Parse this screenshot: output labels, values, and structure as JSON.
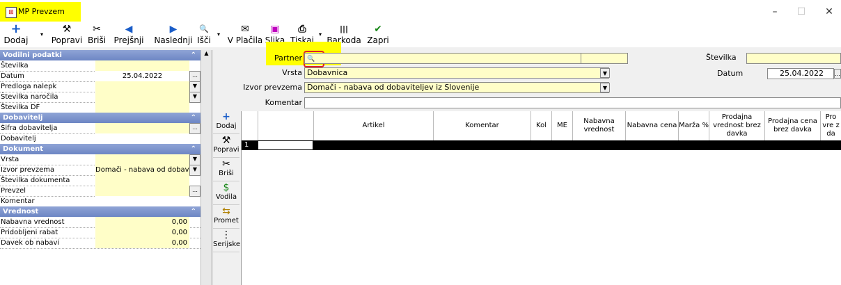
{
  "window": {
    "title": "MP Prevzem",
    "app_icon": "document-icon",
    "minimize": "–",
    "maximize": "☐",
    "close": "✕"
  },
  "toolbar": [
    {
      "label": "Dodaj",
      "icon": "+",
      "color": "#1a5dc8"
    },
    {
      "label": "Popravi",
      "icon": "⚒",
      "color": "#000"
    },
    {
      "label": "Briši",
      "icon": "✂",
      "color": "#000"
    },
    {
      "label": "Prejšnji",
      "icon": "◀",
      "color": "#1a5dc8"
    },
    {
      "label": "Naslednji",
      "icon": "▶",
      "color": "#1a5dc8"
    },
    {
      "label": "Išči",
      "icon": "🔍",
      "color": "#000"
    },
    {
      "label": "V Plačila",
      "icon": "✉",
      "color": "#000"
    },
    {
      "label": "Slika",
      "icon": "▣",
      "color": "#c000c0"
    },
    {
      "label": "Tiskaj",
      "icon": "⎙",
      "color": "#000"
    },
    {
      "label": "Barkoda",
      "icon": "|||",
      "color": "#000"
    },
    {
      "label": "Zapri",
      "icon": "✔",
      "color": "#1c8a1c"
    }
  ],
  "left": {
    "sections": {
      "vodilni": "Vodilni podatki",
      "dobavitelj": "Dobavitelj",
      "dokument": "Dokument",
      "vrednost": "Vrednost"
    },
    "fields": {
      "stevilka": "Številka",
      "datum": "Datum",
      "datum_value": "25.04.2022",
      "predloga": "Predloga nalepk",
      "st_narocila": "Številka naročila",
      "st_df": "Številka DF",
      "sifra_dob": "Šifra dobavitelja",
      "dobavitelj": "Dobavitelj",
      "vrsta": "Vrsta",
      "izvor": "Izvor prevzema",
      "izvor_value": "Domači - nabava od dobavitelje",
      "st_dokumenta": "Številka dokumenta",
      "prevzel": "Prevzel",
      "komentar": "Komentar",
      "nabavna": "Nabavna vrednost",
      "nabavna_value": "0,00",
      "rabat": "Pridobljeni rabat",
      "rabat_value": "0,00",
      "davek": "Davek ob nabavi",
      "davek_value": "0,00"
    }
  },
  "form": {
    "partner_label": "Partner",
    "vrsta_label": "Vrsta",
    "vrsta_value": "Dobavnica",
    "izvor_label": "Izvor prevzema",
    "izvor_value": "Domači - nabava od dobaviteljev iz Slovenije",
    "komentar_label": "Komentar",
    "stevilka_label": "Številka",
    "datum_label": "Datum",
    "datum_value": "25.04.2022"
  },
  "side_buttons": [
    {
      "label": "Dodaj",
      "icon": "+"
    },
    {
      "label": "Popravi",
      "icon": "⚒"
    },
    {
      "label": "Briši",
      "icon": "✂"
    },
    {
      "label": "Vodila",
      "icon": "$"
    },
    {
      "label": "Promet",
      "icon": "⇆"
    },
    {
      "label": "Serijske",
      "icon": "⋮"
    }
  ],
  "grid": {
    "columns": [
      "Artikel",
      "Komentar",
      "Kol",
      "ME",
      "Nabavna vrednost",
      "Nabavna cena",
      "Marža %",
      "Prodajna vrednost brez davka",
      "Prodajna cena brez davka",
      "Pro vre z da"
    ],
    "row_number": "1"
  }
}
